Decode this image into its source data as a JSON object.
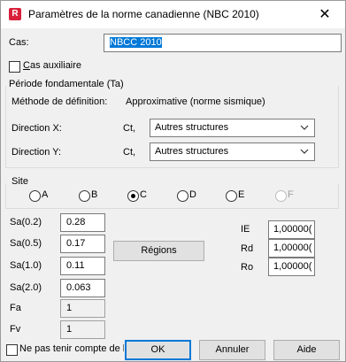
{
  "window": {
    "title": "Paramètres de la norme canadienne (NBC 2010)",
    "app_icon": "R",
    "close_glyph": "✕"
  },
  "cas": {
    "label": "Cas:",
    "value": "NBCC 2010"
  },
  "cas_auxiliaire": {
    "label": "Cas auxiliaire",
    "checked": false
  },
  "periode": {
    "title": "Période fondamentale (Ta)",
    "method_label": "Méthode de définition:",
    "method_value": "Approximative (norme sismique)",
    "dir_x_label": "Direction X:",
    "dir_y_label": "Direction Y:",
    "ct_label": "Ct,",
    "dir_x_value": "Autres structures",
    "dir_y_value": "Autres structures"
  },
  "site": {
    "title": "Site",
    "options": [
      "A",
      "B",
      "C",
      "D",
      "E",
      "F"
    ],
    "selected": "C",
    "disabled": [
      "F"
    ]
  },
  "params": {
    "sa02_label": "Sa(0.2)",
    "sa02_value": "0.28",
    "sa05_label": "Sa(0.5)",
    "sa05_value": "0.17",
    "sa10_label": "Sa(1.0)",
    "sa10_value": "0.11",
    "sa20_label": "Sa(2.0)",
    "sa20_value": "0.063",
    "fa_label": "Fa",
    "fa_value": "1",
    "fv_label": "Fv",
    "fv_value": "1"
  },
  "regions_button": "Régions",
  "factors": {
    "ie_label": "IE",
    "ie_value": "1,00000(",
    "rd_label": "Rd",
    "rd_value": "1,00000(",
    "ro_label": "Ro",
    "ro_value": "1,00000("
  },
  "footer": {
    "ignore_label": "Ne pas tenir compte de la",
    "ok": "OK",
    "cancel": "Annuler",
    "help": "Aide"
  }
}
